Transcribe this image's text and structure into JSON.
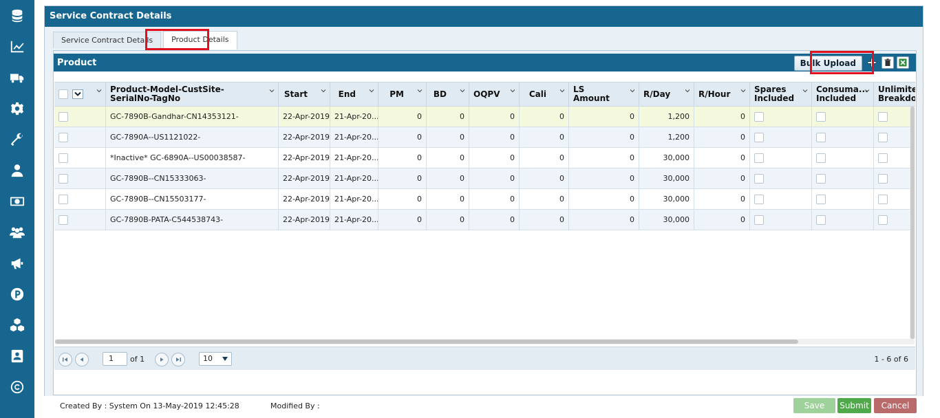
{
  "sidebar": {
    "icons": [
      "database-icon",
      "chart-line-icon",
      "truck-icon",
      "gear-icon",
      "wrench-icon",
      "user-icon",
      "money-icon",
      "users-icon",
      "megaphone-icon",
      "parking-icon",
      "cubes-icon",
      "contact-card-icon",
      "copyright-icon"
    ]
  },
  "panel": {
    "title": "Service Contract Details"
  },
  "tabs": [
    {
      "label": "Service Contract Details",
      "active": false
    },
    {
      "label": "Product Details",
      "active": true
    }
  ],
  "product": {
    "title": "Product",
    "bulk_upload_label": "Bulk Upload"
  },
  "grid": {
    "columns": [
      {
        "key": "check",
        "label": ""
      },
      {
        "key": "name",
        "label": "Product-Model-CustSite-\nSerialNo-TagNo"
      },
      {
        "key": "start",
        "label": "Start"
      },
      {
        "key": "end",
        "label": "End"
      },
      {
        "key": "pm",
        "label": "PM"
      },
      {
        "key": "bd",
        "label": "BD"
      },
      {
        "key": "oqpv",
        "label": "OQPV"
      },
      {
        "key": "cali",
        "label": "Cali"
      },
      {
        "key": "ls",
        "label": "LS\nAmount"
      },
      {
        "key": "rday",
        "label": "R/Day"
      },
      {
        "key": "rhour",
        "label": "R/Hour"
      },
      {
        "key": "spares",
        "label": "Spares\nIncluded"
      },
      {
        "key": "consum",
        "label": "Consuma...\nIncluded"
      },
      {
        "key": "unlim",
        "label": "Unlimited\nBreakdo..."
      }
    ],
    "rows": [
      {
        "name": "GC-7890B-Gandhar-CN14353121-",
        "start": "22-Apr-2019",
        "end": "21-Apr-20...",
        "pm": "0",
        "bd": "0",
        "oqpv": "0",
        "cali": "0",
        "ls": "0",
        "rday": "1,200",
        "rhour": "0"
      },
      {
        "name": "GC-7890A--US1121022-",
        "start": "22-Apr-2019",
        "end": "21-Apr-20...",
        "pm": "0",
        "bd": "0",
        "oqpv": "0",
        "cali": "0",
        "ls": "0",
        "rday": "1,200",
        "rhour": "0"
      },
      {
        "name": "*Inactive* GC-6890A--US00038587-",
        "start": "22-Apr-2019",
        "end": "21-Apr-20...",
        "pm": "0",
        "bd": "0",
        "oqpv": "0",
        "cali": "0",
        "ls": "0",
        "rday": "30,000",
        "rhour": "0"
      },
      {
        "name": "GC-7890B--CN15333063-",
        "start": "22-Apr-2019",
        "end": "21-Apr-20...",
        "pm": "0",
        "bd": "0",
        "oqpv": "0",
        "cali": "0",
        "ls": "0",
        "rday": "30,000",
        "rhour": "0"
      },
      {
        "name": "GC-7890B--CN15503177-",
        "start": "22-Apr-2019",
        "end": "21-Apr-20...",
        "pm": "0",
        "bd": "0",
        "oqpv": "0",
        "cali": "0",
        "ls": "0",
        "rday": "30,000",
        "rhour": "0"
      },
      {
        "name": "GC-7890B-PATA-C544538743-",
        "start": "22-Apr-2019",
        "end": "21-Apr-20...",
        "pm": "0",
        "bd": "0",
        "oqpv": "0",
        "cali": "0",
        "ls": "0",
        "rday": "30,000",
        "rhour": "0"
      }
    ]
  },
  "pager": {
    "page": "1",
    "of_text": "of 1",
    "page_size": "10",
    "range_text": "1 - 6 of 6"
  },
  "footer": {
    "created_by": "Created By : System On 13-May-2019 12:45:28",
    "modified_by": "Modified By :",
    "save_label": "Save",
    "submit_label": "Submit",
    "cancel_label": "Cancel"
  },
  "colors": {
    "header_blue": "#166690",
    "highlight_red": "#e01020",
    "save_green_disabled": "#9fd19a",
    "submit_green": "#4fa84a",
    "cancel_red": "#b96a6a"
  }
}
